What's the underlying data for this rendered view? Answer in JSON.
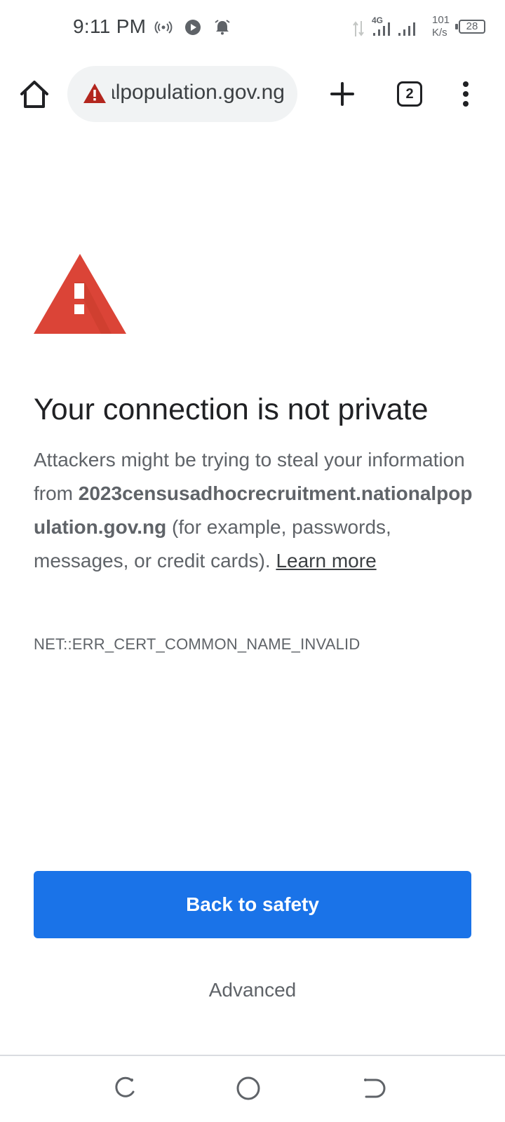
{
  "status_bar": {
    "time": "9:11 PM",
    "net_speed_value": "101",
    "net_speed_unit": "K/s",
    "network_type": "4G",
    "battery": "28",
    "icons": [
      "hotspot-icon",
      "play-icon",
      "alarm-icon",
      "data-arrows-icon",
      "signal-icon",
      "signal-icon",
      "battery-icon"
    ]
  },
  "toolbar": {
    "url": "2023censusadhocrecruitment.nationalpopulation.gov.ng",
    "tab_count": "2",
    "icons": [
      "home-icon",
      "warning-icon",
      "plus-icon",
      "tab-switcher-icon",
      "more-vert-icon"
    ]
  },
  "content": {
    "heading": "Your connection is not private",
    "body_prefix": "Attackers might be trying to steal your information from ",
    "domain": "2023censusadhocrecruitment.nationalpopulation.gov.ng",
    "body_suffix": " (for example, passwords, messages, or credit cards). ",
    "learn_more": "Learn more",
    "error_code": "NET::ERR_CERT_COMMON_NAME_INVALID",
    "primary_button": "Back to safety",
    "secondary_button": "Advanced"
  },
  "colors": {
    "primary": "#1a73e8",
    "warning": "#db4437",
    "text": "#202124",
    "secondary_text": "#5f6368"
  },
  "nav_bar": {
    "icons": [
      "recents-icon",
      "home-circle-icon",
      "back-icon"
    ]
  }
}
